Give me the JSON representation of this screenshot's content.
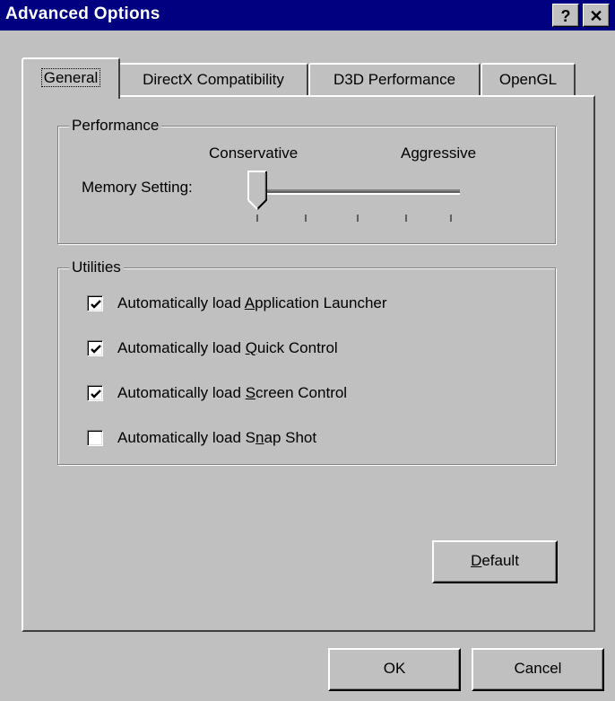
{
  "window": {
    "title": "Advanced Options",
    "help_button": "?",
    "close_button": "✕"
  },
  "tabs": [
    {
      "label": "General",
      "active": true
    },
    {
      "label": "DirectX Compatibility",
      "active": false
    },
    {
      "label": "D3D Performance",
      "active": false
    },
    {
      "label": "OpenGL",
      "active": false
    }
  ],
  "performance": {
    "group_label": "Performance",
    "left_label": "Conservative",
    "right_label": "Aggressive",
    "memory_label": "Memory Setting:",
    "slider_value": 0,
    "slider_positions": 5
  },
  "utilities": {
    "group_label": "Utilities",
    "items": [
      {
        "prefix": "Automatically load ",
        "mnemonic": "A",
        "suffix": "pplication Launcher",
        "checked": true
      },
      {
        "prefix": "Automatically load ",
        "mnemonic": "Q",
        "suffix": "uick Control",
        "checked": true
      },
      {
        "prefix": "Automatically load ",
        "mnemonic": "S",
        "suffix": "creen Control",
        "checked": true
      },
      {
        "prefix": "Automatically load S",
        "mnemonic": "n",
        "suffix": "ap Shot",
        "checked": false
      }
    ]
  },
  "buttons": {
    "default_mnemonic": "D",
    "default_rest": "efault",
    "ok": "OK",
    "cancel": "Cancel"
  }
}
